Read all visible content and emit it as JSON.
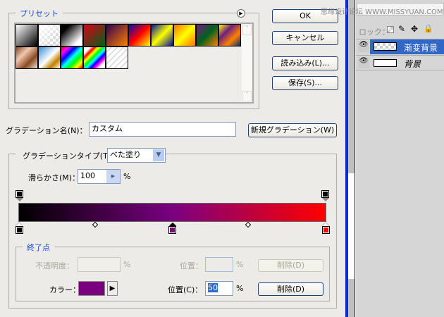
{
  "presets": {
    "legend": "プリセット",
    "swatch_count": 15
  },
  "buttons": {
    "ok": "OK",
    "cancel": "キャンセル",
    "load": "読み込み(L)...",
    "save": "保存(S)...",
    "new_gradient": "新規グラデーション(W)",
    "delete_opacity": "削除(D)",
    "delete_color": "削除(D)"
  },
  "name_field": {
    "label": "グラデーション名(N)：",
    "value": "カスタム"
  },
  "gradient_type": {
    "label": "グラデーションタイプ(T)：",
    "value": "べた塗り"
  },
  "smoothness": {
    "label": "滑らかさ(M)：",
    "value": "100",
    "unit": "%"
  },
  "gradient": {
    "stops": [
      {
        "color": "#000000",
        "location": 0
      },
      {
        "color": "#7a0080",
        "location": 50
      },
      {
        "color": "#ff0000",
        "location": 100
      }
    ],
    "midpoints": [
      25,
      75
    ]
  },
  "endpoint": {
    "legend": "終了点",
    "opacity_label": "不透明度：",
    "opacity_unit": "%",
    "position_label_disabled": "位置：",
    "position_unit_disabled": "%",
    "color_label": "カラー：",
    "color": "#7a0080",
    "position_label": "位置(C)：",
    "position_value": "50",
    "position_unit": "%"
  },
  "layers": {
    "watermark": "思缘设计论坛 WWW.MISSYUAN.COM",
    "lock_label": "ロック：",
    "items": [
      {
        "name": "渐变背景",
        "selected": true
      },
      {
        "name": "背景",
        "selected": false
      }
    ]
  }
}
